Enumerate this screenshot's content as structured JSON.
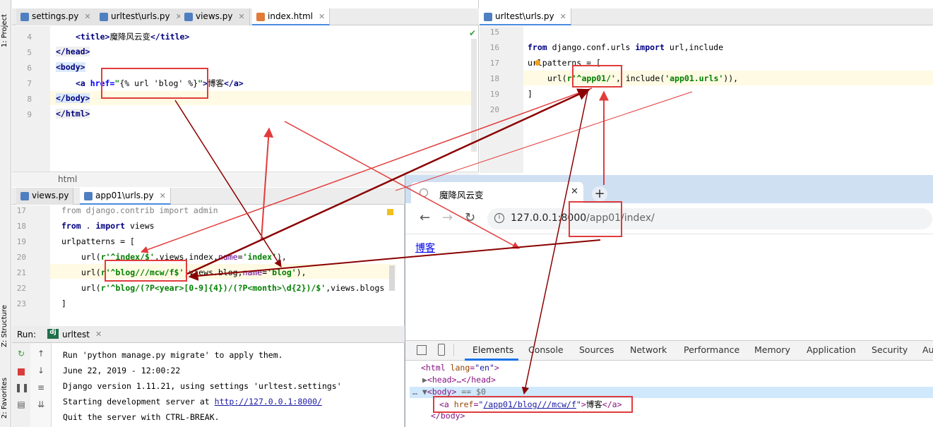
{
  "ide": {
    "top_tabs": [
      {
        "label": "settings.py"
      },
      {
        "label": "urltest\\urls.py"
      },
      {
        "label": "views.py"
      },
      {
        "label": "index.html"
      }
    ],
    "right_top_tab": "urltest\\urls.py",
    "bottom_tabs": [
      {
        "label": "views.py"
      },
      {
        "label": "app01\\urls.py"
      }
    ],
    "sidebar": {
      "project": "1: Project",
      "structure": "Z: Structure",
      "favorites": "2: Favorites"
    },
    "breadcrumb": "html"
  },
  "index_html": {
    "lines": [
      "4",
      "5",
      "6",
      "7",
      "8",
      "9"
    ],
    "title_text": "魔降风云变",
    "a_href": "{% url 'blog' %}",
    "a_text": "博客"
  },
  "project_urls": {
    "lines": [
      "15",
      "16",
      "17",
      "18",
      "19",
      "20"
    ],
    "import_line": "django.conf.urls",
    "import_names": "url,include",
    "pattern_prefix": "r'^app01/'",
    "include_arg": "'app01.urls'"
  },
  "app_urls": {
    "lines": [
      "17",
      "18",
      "19",
      "20",
      "21",
      "22",
      "23"
    ],
    "line17": "from django.contrib import admin",
    "route1": "r'^index/$'",
    "name1": "'index'",
    "route2": "r'^blog///mcw/f$'",
    "name2": "'blog'",
    "route3": "r'^blog/(?P<year>[0-9]{4})/(?P<month>\\d{2})/$'",
    "view3": "views.blogs"
  },
  "run_panel": {
    "label": "Run:",
    "config": "urltest",
    "lines": [
      "Run 'python manage.py migrate' to apply them.",
      "June 22, 2019 - 12:00:22",
      "Django version 1.11.21, using settings 'urltest.settings'",
      "Starting development server at ",
      "Quit the server with CTRL-BREAK."
    ],
    "server_url": "http://127.0.0.1:8000/"
  },
  "browser": {
    "tab_title": "魔降风云变",
    "url_host": "127.0.0.1:8000",
    "url_path": "/app01/index/",
    "page_link": "博客",
    "devtools_tabs": [
      "Elements",
      "Console",
      "Sources",
      "Network",
      "Performance",
      "Memory",
      "Application",
      "Security",
      "Au"
    ],
    "dom": {
      "html_lang": "en",
      "head": "<head>…</head>",
      "body_marker": "== $0",
      "a_href": "/app01/blog///mcw/f",
      "a_text": "博客"
    }
  },
  "colors": {
    "annotation_red": "#e23b3b",
    "annotation_dark": "#8b0000"
  }
}
